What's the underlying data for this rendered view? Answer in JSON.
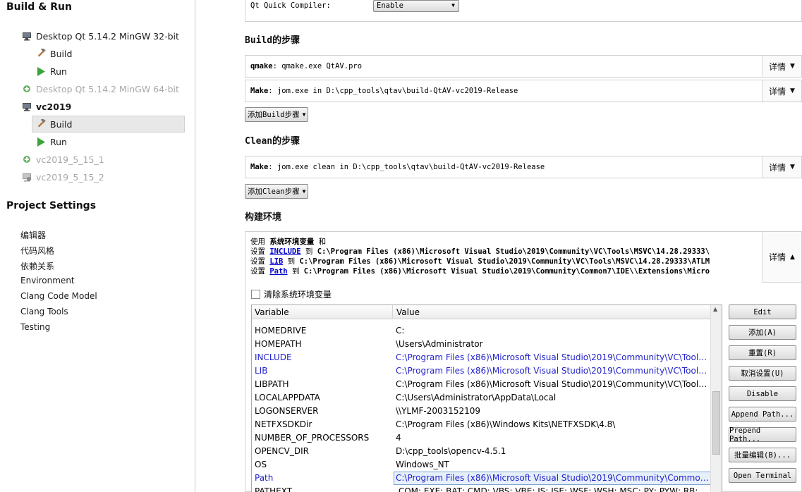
{
  "left": {
    "build_run_title": "Build & Run",
    "kits": [
      {
        "label": "Desktop Qt 5.14.2 MinGW 32-bit",
        "icon": "monitor-icon"
      },
      {
        "label": "Build",
        "icon": "hammer-icon"
      },
      {
        "label": "Run",
        "icon": "play-icon"
      },
      {
        "label": "Desktop Qt 5.14.2 MinGW 64-bit",
        "icon": "add-kit-icon"
      },
      {
        "label": "vc2019",
        "icon": "monitor-icon"
      },
      {
        "label": "Build",
        "icon": "hammer-icon"
      },
      {
        "label": "Run",
        "icon": "play-icon"
      },
      {
        "label": "vc2019_5_15_1",
        "icon": "add-kit-icon"
      },
      {
        "label": "vc2019_5_15_2",
        "icon": "monitor-warning-icon"
      }
    ],
    "project_settings_title": "Project Settings",
    "settings": [
      "编辑器",
      "代码风格",
      "依赖关系",
      "Environment",
      "Clang Code Model",
      "Clang Tools",
      "Testing"
    ]
  },
  "qt_quick": {
    "label": "Qt Quick Compiler:",
    "value": "Enable"
  },
  "build": {
    "heading": "Build的步骤",
    "steps": [
      {
        "key": "qmake",
        "text": ": qmake.exe QtAV.pro"
      },
      {
        "key": "Make",
        "text": ": jom.exe in D:\\cpp_tools\\qtav\\build-QtAV-vc2019-Release"
      }
    ],
    "add_label": "添加Build步骤"
  },
  "clean": {
    "heading": "Clean的步骤",
    "steps": [
      {
        "key": "Make",
        "text": ": jom.exe clean in D:\\cpp_tools\\qtav\\build-QtAV-vc2019-Release"
      }
    ],
    "add_label": "添加Clean步骤"
  },
  "details_label": "详情",
  "env": {
    "heading": "构建环境",
    "summary": {
      "line1_pre": "使用 ",
      "line1_bold": "系统环境变量",
      "line1_post": " 和",
      "set_word": "设置 ",
      "to_word": " 到 ",
      "vars": [
        {
          "name": "INCLUDE",
          "value": "C:\\Program Files (x86)\\Microsoft Visual Studio\\2019\\Community\\VC\\Tools\\MSVC\\14.28.29333\\"
        },
        {
          "name": "LIB",
          "value": "C:\\Program Files (x86)\\Microsoft Visual Studio\\2019\\Community\\VC\\Tools\\MSVC\\14.28.29333\\ATLM"
        },
        {
          "name": "Path",
          "value": "C:\\Program Files (x86)\\Microsoft Visual Studio\\2019\\Community\\Common7\\IDE\\\\Extensions\\Micro"
        }
      ]
    },
    "clear_label": "清除系统环境变量",
    "clear_checked": false,
    "columns": [
      "Variable",
      "Value"
    ],
    "rows": [
      {
        "name": "HOMEDRIVE",
        "value": "C:",
        "changed": false
      },
      {
        "name": "HOMEPATH",
        "value": "\\Users\\Administrator",
        "changed": false
      },
      {
        "name": "INCLUDE",
        "value": "C:\\Program Files (x86)\\Microsoft Visual Studio\\2019\\Community\\VC\\Tools\\...",
        "changed": true
      },
      {
        "name": "LIB",
        "value": "C:\\Program Files (x86)\\Microsoft Visual Studio\\2019\\Community\\VC\\Tools\\...",
        "changed": true
      },
      {
        "name": "LIBPATH",
        "value": "C:\\Program Files (x86)\\Microsoft Visual Studio\\2019\\Community\\VC\\Tools\\...",
        "changed": false
      },
      {
        "name": "LOCALAPPDATA",
        "value": "C:\\Users\\Administrator\\AppData\\Local",
        "changed": false
      },
      {
        "name": "LOGONSERVER",
        "value": "\\\\YLMF-2003152109",
        "changed": false
      },
      {
        "name": "NETFXSDKDir",
        "value": "C:\\Program Files (x86)\\Windows Kits\\NETFXSDK\\4.8\\",
        "changed": false
      },
      {
        "name": "NUMBER_OF_PROCESSORS",
        "value": "4",
        "changed": false
      },
      {
        "name": "OPENCV_DIR",
        "value": "D:\\cpp_tools\\opencv-4.5.1",
        "changed": false
      },
      {
        "name": "OS",
        "value": "Windows_NT",
        "changed": false
      },
      {
        "name": "Path",
        "value": "C:\\Program Files (x86)\\Microsoft Visual Studio\\2019\\Community\\Common...",
        "changed": true,
        "selected": true
      },
      {
        "name": "PATHEXT",
        "value": ".COM;.EXE;.BAT;.CMD;.VBS;.VBE;.JS;.JSE;.WSF;.WSH;.MSC;.PY;.PYW;.RB;.RBW",
        "changed": false
      }
    ],
    "buttons": [
      "Edit",
      "添加(A)",
      "重置(R)",
      "取消设置(U)",
      "Disable",
      "Append Path...",
      "Prepend Path...",
      "批量编辑(B)...",
      "Open Terminal"
    ]
  },
  "colors": {
    "changed_var": "#2222cc",
    "link": "#0000cc",
    "run_green": "#3aa33a"
  }
}
